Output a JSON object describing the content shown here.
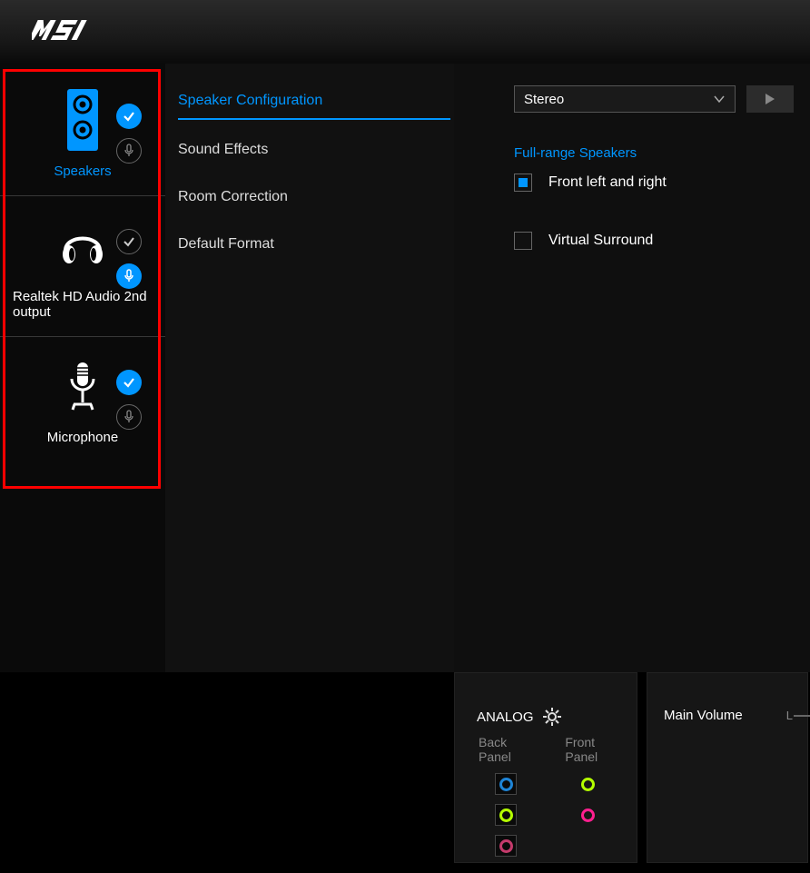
{
  "brand": "msi",
  "sidebar": {
    "devices": [
      {
        "label": "Speakers",
        "active": true
      },
      {
        "label": "Realtek HD Audio 2nd output",
        "active": false
      },
      {
        "label": "Microphone",
        "active": false
      }
    ]
  },
  "tabs": [
    {
      "label": "Speaker Configuration",
      "active": true
    },
    {
      "label": "Sound Effects",
      "active": false
    },
    {
      "label": "Room Correction",
      "active": false
    },
    {
      "label": "Default Format",
      "active": false
    }
  ],
  "config": {
    "dropdown_value": "Stereo",
    "section_title": "Full-range Speakers",
    "front_lr_label": "Front left and right",
    "front_lr_checked": true,
    "virtual_label": "Virtual Surround",
    "virtual_checked": false
  },
  "analog": {
    "title": "ANALOG",
    "back_label": "Back Panel",
    "front_label": "Front Panel",
    "back_jacks": [
      "#1e84d6",
      "#b4ff00",
      "#c43a6b"
    ],
    "front_jacks": [
      "#b4ff00",
      "#ff1f8f"
    ]
  },
  "volume": {
    "title": "Main Volume",
    "channel": "L"
  }
}
